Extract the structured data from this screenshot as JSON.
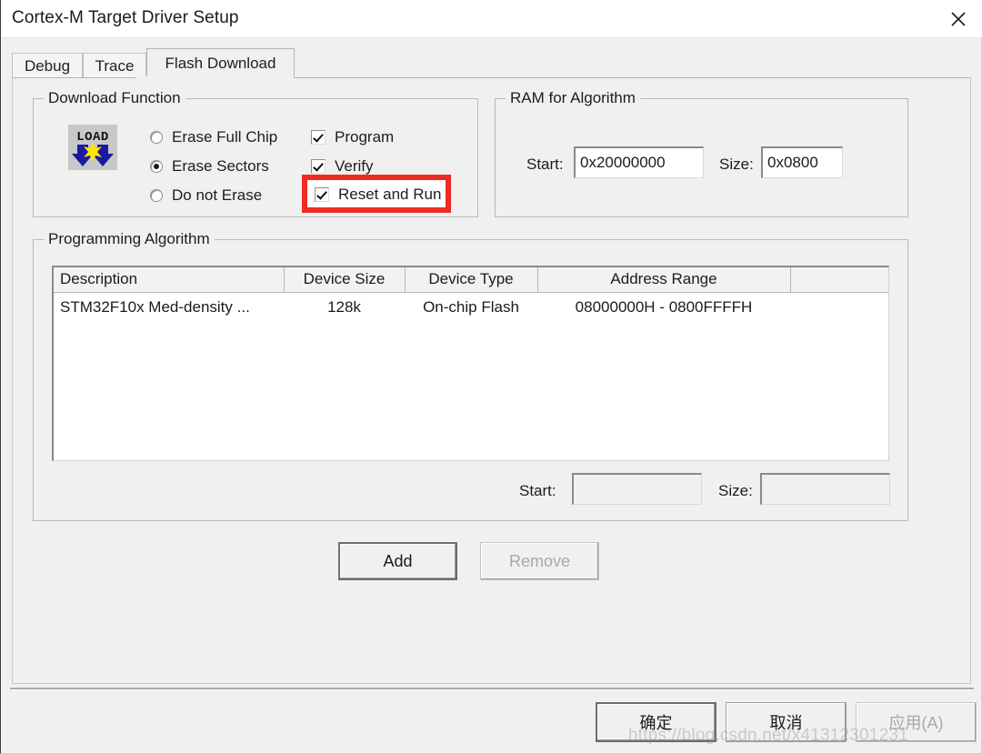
{
  "window": {
    "title": "Cortex-M Target Driver Setup",
    "close_icon": "close-icon"
  },
  "tabs": [
    {
      "label": "Debug",
      "active": false
    },
    {
      "label": "Trace",
      "active": false
    },
    {
      "label": "Flash Download",
      "active": true
    }
  ],
  "download_function": {
    "group_title": "Download Function",
    "icon_label": "LOAD",
    "erase_options": [
      {
        "label": "Erase Full Chip",
        "checked": false
      },
      {
        "label": "Erase Sectors",
        "checked": true
      },
      {
        "label": "Do not Erase",
        "checked": false
      }
    ],
    "checkboxes": [
      {
        "label": "Program",
        "checked": true
      },
      {
        "label": "Verify",
        "checked": true
      },
      {
        "label": "Reset and Run",
        "checked": true,
        "highlighted": true
      }
    ],
    "highlight_color": "#ee2b24"
  },
  "ram_for_algorithm": {
    "group_title": "RAM for Algorithm",
    "start_label": "Start:",
    "start_value": "0x20000000",
    "size_label": "Size:",
    "size_value": "0x0800"
  },
  "programming_algorithm": {
    "group_title": "Programming Algorithm",
    "columns": [
      "Description",
      "Device Size",
      "Device Type",
      "Address Range",
      ""
    ],
    "rows": [
      {
        "description": "STM32F10x Med-density ...",
        "device_size": "128k",
        "device_type": "On-chip Flash",
        "address_range": "08000000H - 0800FFFFH",
        "extra": ""
      }
    ],
    "start_label": "Start:",
    "start_value": "",
    "size_label": "Size:",
    "size_value": "",
    "add_button": "Add",
    "remove_button": "Remove"
  },
  "footer": {
    "ok_button": "确定",
    "cancel_button": "取消",
    "apply_button": "应用(A)"
  },
  "watermark": "https://blog.csdn.net/x41312301231"
}
